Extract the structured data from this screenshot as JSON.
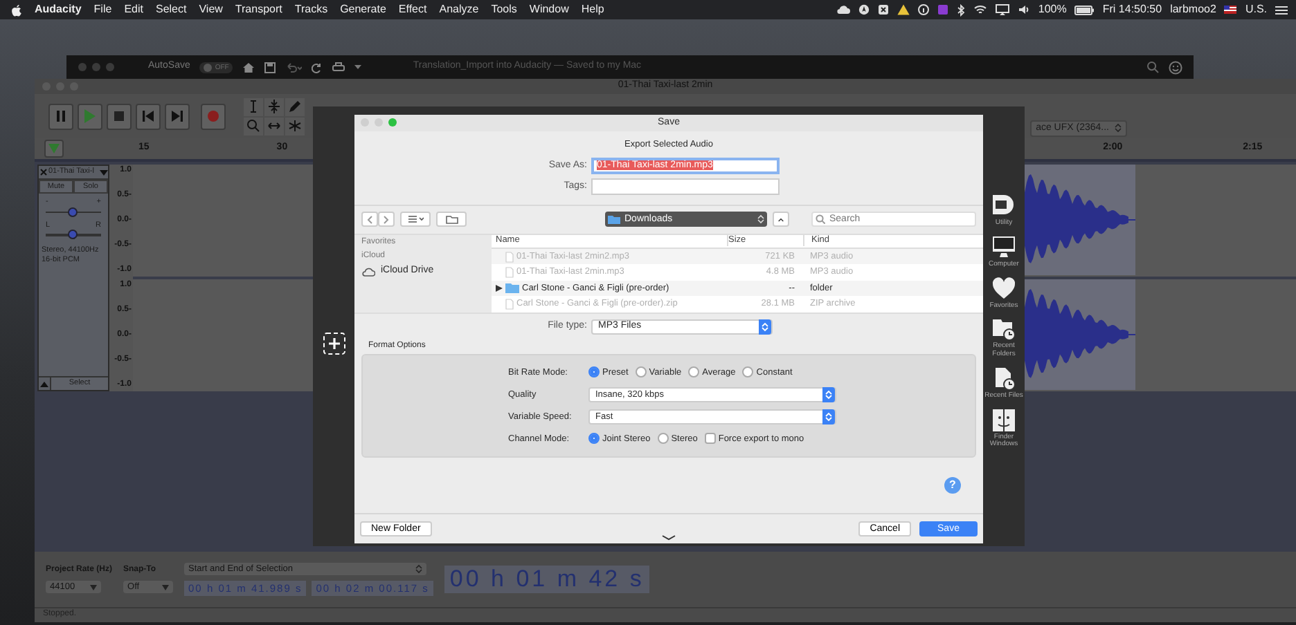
{
  "menu_bar": {
    "app_name": "Audacity",
    "menus": [
      "File",
      "Edit",
      "Select",
      "View",
      "Transport",
      "Tracks",
      "Generate",
      "Effect",
      "Analyze",
      "Tools",
      "Window",
      "Help"
    ],
    "battery": "100%",
    "clock": "Fri 14:50:50",
    "user": "larbmoo2",
    "input_source": "U.S."
  },
  "document_window": {
    "autosave": "AutoSave",
    "autosave_toggle": {
      "label": "OFF",
      "on": false
    },
    "title": "Translation_Import into Audacity — Saved to my Mac"
  },
  "audacity_window": {
    "title": "01-Thai Taxi-last 2min",
    "device": "ace UFX (2364...",
    "ruler": [
      "15",
      "30",
      "2:00",
      "2:15"
    ],
    "track": {
      "name": "01-Thai Taxi-l",
      "buttons": [
        "Mute",
        "Solo"
      ],
      "sliders": [
        {
          "kind": "gain",
          "min_label": "-",
          "max_label": "+",
          "level": 0.5
        },
        {
          "kind": "pan",
          "min_label": "L",
          "max_label": "R",
          "level": 0.5
        }
      ],
      "info_lines": [
        "Stereo, 44100Hz",
        "16-bit PCM"
      ],
      "select": "Select",
      "channels": [
        {
          "scale": [
            "1.0",
            "0.5-",
            "0.0-",
            "-0.5-",
            "-1.0"
          ]
        },
        {
          "scale": [
            "1.0",
            "0.5-",
            "0.0-",
            "-0.5-",
            "-1.0"
          ]
        }
      ]
    },
    "selection_bar": {
      "project_rate_label": "Project Rate (Hz)",
      "project_rate": "44100",
      "snap_label": "Snap-To",
      "snap": "Off",
      "selection_mode": "Start and End of Selection",
      "start": "00 h 01 m 41.989 s",
      "end": "00 h 02 m 00.117 s",
      "position": "00 h 01 m 42 s"
    },
    "status": "Stopped."
  },
  "save_dialog": {
    "title": "Save",
    "heading": "Export Selected Audio",
    "save_as_label": "Save As:",
    "save_as_value": "01-Thai Taxi-last 2min.mp3",
    "tags_label": "Tags:",
    "location": "Downloads",
    "search_placeholder": "Search",
    "sidebar": [
      {
        "kind": "heading",
        "label": "Favorites"
      },
      {
        "kind": "heading",
        "label": "iCloud"
      },
      {
        "kind": "item",
        "label": "iCloud Drive"
      }
    ],
    "columns": [
      "Name",
      "Size",
      "Kind"
    ],
    "files": [
      {
        "kind": "file",
        "name": "01-Thai Taxi-last 2min2.mp3",
        "size": "721 KB",
        "type": "MP3 audio",
        "disabled": true
      },
      {
        "kind": "file",
        "name": "01-Thai Taxi-last 2min.mp3",
        "size": "4.8 MB",
        "type": "MP3 audio",
        "disabled": true
      },
      {
        "kind": "folder",
        "name": "Carl Stone - Ganci & Figli (pre-order)",
        "size": "--",
        "type": "folder",
        "disabled": false
      },
      {
        "kind": "file",
        "name": "Carl Stone - Ganci & Figli (pre-order).zip",
        "size": "28.1 MB",
        "type": "ZIP archive",
        "disabled": true
      }
    ],
    "file_type_label": "File type:",
    "file_type": "MP3 Files",
    "format_options_label": "Format Options",
    "bit_rate_label": "Bit Rate Mode:",
    "bit_rate_modes": [
      {
        "label": "Preset",
        "selected": true
      },
      {
        "label": "Variable",
        "selected": false
      },
      {
        "label": "Average",
        "selected": false
      },
      {
        "label": "Constant",
        "selected": false
      }
    ],
    "quality_label": "Quality",
    "quality": "Insane, 320 kbps",
    "speed_label": "Variable Speed:",
    "speed": "Fast",
    "channel_label": "Channel Mode:",
    "channel_modes": [
      {
        "label": "Joint Stereo",
        "selected": true
      },
      {
        "label": "Stereo",
        "selected": false
      }
    ],
    "force_mono": {
      "label": "Force export to mono",
      "checked": false
    },
    "help": "?",
    "new_folder": "New Folder",
    "cancel": "Cancel",
    "save": "Save"
  },
  "side_panel": {
    "items": [
      {
        "kind": "utility",
        "label": "Utility"
      },
      {
        "kind": "computer",
        "label": "Computer"
      },
      {
        "kind": "favorites",
        "label": "Favorites"
      },
      {
        "kind": "recent_folders",
        "label": "Recent Folders"
      },
      {
        "kind": "recent_files",
        "label": "Recent Files"
      },
      {
        "kind": "finder",
        "label": "Finder Windows"
      }
    ]
  }
}
